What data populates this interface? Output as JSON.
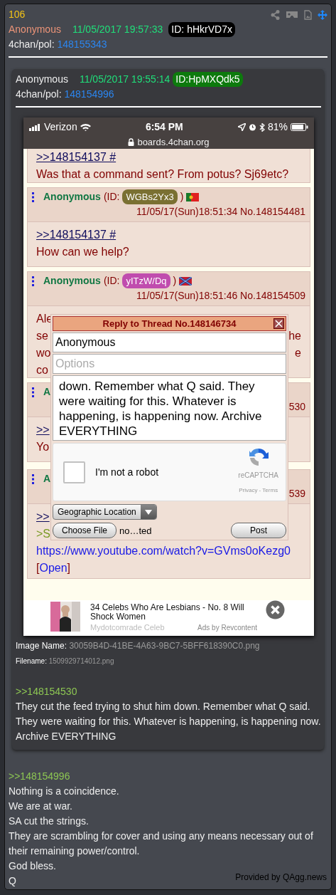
{
  "post": {
    "number": "106",
    "name": "Anonymous",
    "datetime": "11/05/2017 19:57:33",
    "id": "ID: hHkrVD7x",
    "board": "4chan/pol:",
    "post_no": "148155343",
    "quoted": {
      "name": "Anonymous",
      "datetime": "11/05/2017 19:55:14",
      "id": "ID:HpMXQdk5",
      "board": "4chan/pol:",
      "post_no": "148154996",
      "screenshot": {
        "status": {
          "carrier": "Verizon",
          "time": "6:54 PM",
          "battery": "81%",
          "url": "boards.4chan.org"
        },
        "posts": [
          {
            "body": [
              {
                "kind": "link",
                "text": ">>148154137 #"
              },
              {
                "kind": "text",
                "text": "Was that a command sent? From potus? Sj69etc?"
              }
            ]
          },
          {
            "header": {
              "name": "Anonymous",
              "id_open": "(ID:",
              "id": {
                "text": "WGBs2Yx3",
                "color": "#7a7032"
              },
              "id_close": ")",
              "flag": {
                "kind": "bicolor"
              },
              "datetime": "11/05/17(Sun)18:51:34",
              "no": "No.148154481"
            },
            "body": [
              {
                "kind": "link",
                "text": ">>148154137 #"
              },
              {
                "kind": "text",
                "text": "How can we help?"
              }
            ]
          },
          {
            "header": {
              "name": "Anonymous",
              "id_open": "(ID:",
              "id": {
                "text": "yITzW/Dq",
                "color": "#c04cae"
              },
              "id_close": ")",
              "flag": {
                "kind": "saltire"
              },
              "datetime": "11/05/17(Sun)18:51:46",
              "no": "No.148154509"
            },
            "body": [
              {
                "kind": "split",
                "left": "Ale"
              },
              {
                "kind": "split",
                "left": "se",
                "right": "he"
              },
              {
                "kind": "split",
                "left": "wo",
                "right": "e"
              },
              {
                "kind": "split",
                "left": "co"
              }
            ]
          },
          {
            "header": {
              "name": "A",
              "no": "530"
            },
            "body": [
              {
                "kind": "link",
                "text": ">>"
              },
              {
                "kind": "text",
                "text": "Yo"
              }
            ]
          },
          {
            "header": {
              "name": "A",
              "no": "539"
            },
            "body": [
              {
                "kind": "link",
                "text": ">>"
              },
              {
                "kind": "greentext",
                "text": ">S"
              },
              {
                "kind": "url",
                "text": "https://www.youtube.com/watch?v=GVms0oKezg0"
              },
              {
                "kind": "open",
                "before": "[",
                "text": "Open",
                "after": "]"
              }
            ]
          }
        ],
        "form": {
          "title": "Reply to Thread No.148146734",
          "name_value": "Anonymous",
          "options_placeholder": "Options",
          "comment": "down. Remember what Q said. They were waiting for this. Whatever is happening, is happening now. Archive EVERYTHING",
          "captcha": {
            "label": "I'm not a robot",
            "checked": false,
            "brand": "reCAPTCHA",
            "links": "Privacy - Terms"
          },
          "location": "Geographic Location",
          "file_button": "Choose File",
          "file_status": "no…ted",
          "post_button": "Post"
        },
        "ad": {
          "title": "34 Celebs Who Are Lesbians - No. 8 Will Shock Women",
          "source": "Mydotcomrade Celeb",
          "by": "Ads by Revcontent"
        }
      },
      "image_name_label": "Image Name:",
      "image_name": "30059B4D-41BE-4A63-9BC7-5BFF618390C0.png",
      "filename_label": "Filename:",
      "filename": "1509929714012.png",
      "reply_to": ">>148154530",
      "body": [
        "They cut the feed trying to shut him down. Remember what Q said. They were waiting for this. Whatever is happening, is happening now. Archive EVERYTHING"
      ]
    },
    "reply_to": ">>148154996",
    "body": [
      "Nothing is a coincidence.",
      "We are at war.",
      "SA cut the strings.",
      "They are scrambling for cover and using any means necessary out of their remaining power/control.",
      "God bless.",
      "Q"
    ]
  },
  "footer": "Provided by QAgg.news"
}
